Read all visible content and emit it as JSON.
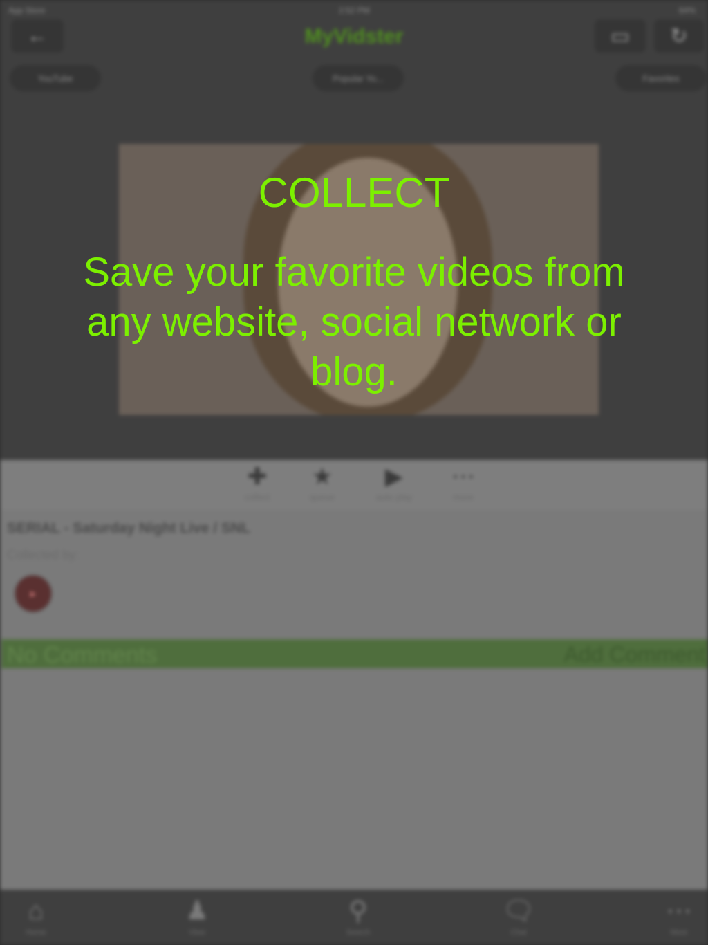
{
  "status_bar": {
    "carrier": "App Store",
    "time": "2:52 PM",
    "battery": "64%"
  },
  "header": {
    "title": "MyVidster",
    "back_icon": "back-arrow-icon",
    "cast_icon": "cast-icon",
    "refresh_icon": "refresh-icon"
  },
  "tabs": [
    {
      "label": "YouTube"
    },
    {
      "label": "Popular Yo..."
    },
    {
      "label": "Favorites"
    }
  ],
  "actions": [
    {
      "label": "collect",
      "icon": "plus-icon"
    },
    {
      "label": "queue",
      "icon": "star-icon"
    },
    {
      "label": "auto play",
      "icon": "play-icon"
    },
    {
      "label": "more",
      "icon": "more-icon"
    }
  ],
  "video": {
    "title": "SERIAL - Saturday Night Live / SNL",
    "collected_by_label": "Collected by:"
  },
  "comments": {
    "count_label": "No Comments",
    "add_label": "Add Comment"
  },
  "bottom_nav": [
    {
      "label": "Home",
      "icon": "home-icon"
    },
    {
      "label": "View",
      "icon": "user-icon"
    },
    {
      "label": "Search",
      "icon": "search-icon"
    },
    {
      "label": "Chat",
      "icon": "chat-icon"
    },
    {
      "label": "More",
      "icon": "more-icon"
    }
  ],
  "overlay": {
    "heading": "COLLECT",
    "body": "Save your favorite videos from any website, social network or blog.",
    "text_color": "#7cf000"
  }
}
